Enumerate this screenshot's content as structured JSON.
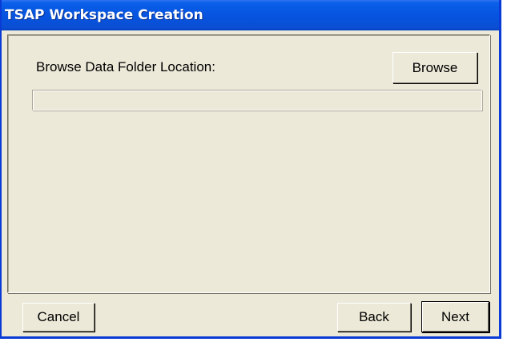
{
  "window": {
    "title": "TSAP Workspace Creation"
  },
  "main": {
    "browse_label": "Browse Data Folder Location:",
    "browse_button": "Browse",
    "path_value": ""
  },
  "footer": {
    "cancel_label": "Cancel",
    "back_label": "Back",
    "next_label": "Next"
  },
  "colors": {
    "titlebar": "#0654e0",
    "window_face": "#ece9d8",
    "window_border": "#0a3bd6"
  }
}
